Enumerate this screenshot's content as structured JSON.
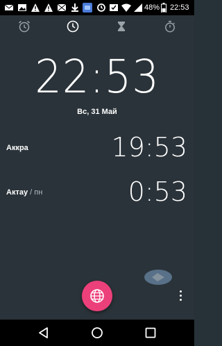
{
  "status_bar": {
    "icons": [
      "mail-icon",
      "image-icon",
      "warning-icon",
      "warning-icon",
      "mail-envelope-icon",
      "download-icon",
      "app-icon",
      "sync-icon",
      "inbox-check-icon",
      "wifi-icon",
      "signal-icon",
      "battery-icon"
    ],
    "battery": "48%",
    "time": "22:53"
  },
  "tabs": [
    {
      "name": "alarm",
      "icon": "alarm-icon",
      "selected": false
    },
    {
      "name": "clock",
      "icon": "clock-icon",
      "selected": true
    },
    {
      "name": "timer",
      "icon": "hourglass-icon",
      "selected": false
    },
    {
      "name": "stopwatch",
      "icon": "stopwatch-icon",
      "selected": false
    }
  ],
  "clock": {
    "time": "22:53",
    "date": "Вс, 31 Май"
  },
  "cities": [
    {
      "name": "Аккра",
      "suffix": "",
      "time": "19:53"
    },
    {
      "name": "Актау",
      "suffix": " / пн",
      "time": "0:53"
    }
  ],
  "fab": {
    "icon": "globe-icon",
    "color": "#ec407a"
  },
  "menu": {
    "icon": "more-vert-icon"
  },
  "nav": {
    "icons": [
      "back-icon",
      "home-icon",
      "recents-icon"
    ]
  },
  "colors": {
    "background": "#2a3339",
    "accent": "#ec407a",
    "inactive_tab": "#9aa3a8"
  }
}
